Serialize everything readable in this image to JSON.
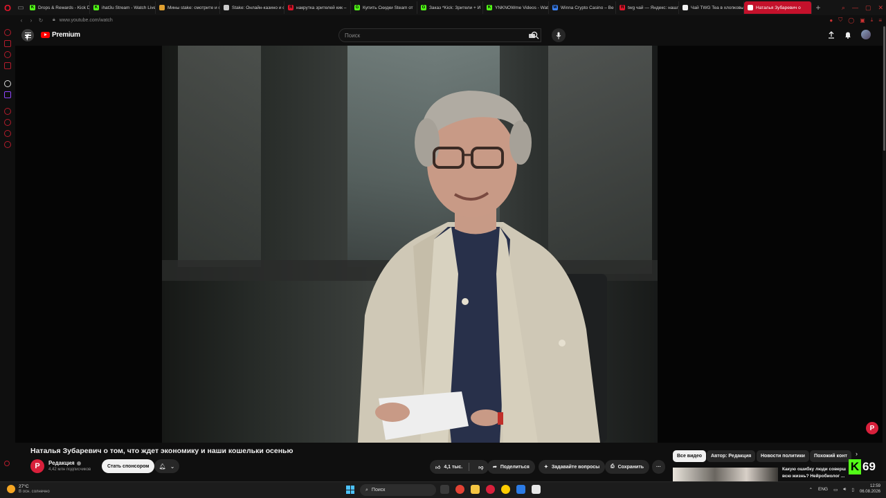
{
  "browser": {
    "tabs": [
      {
        "label": "Drops & Rewards - Kick Dr",
        "favicon_color": "#53fc18",
        "fav_text": "K"
      },
      {
        "label": "ihat3u Stream - Watch Live",
        "favicon_color": "#53fc18",
        "fav_text": "K"
      },
      {
        "label": "Мины stake: смотрите и с",
        "favicon_color": "#e0a030",
        "fav_text": ""
      },
      {
        "label": "Stake: Онлайн-казино и с",
        "favicon_color": "#cccccc",
        "fav_text": ""
      },
      {
        "label": "накрутка зрителей кик –",
        "favicon_color": "#e0162b",
        "fav_text": "Я"
      },
      {
        "label": "Купить Скидки Steam от",
        "favicon_color": "#53fc18",
        "fav_text": "G"
      },
      {
        "label": "Заказ *Kick: Зрители + И",
        "favicon_color": "#53fc18",
        "fav_text": "G"
      },
      {
        "label": "YNKNOWme Videos - Wat",
        "favicon_color": "#53fc18",
        "fav_text": "K"
      },
      {
        "label": "Winna Crypto Casino – Be",
        "favicon_color": "#3b82f6",
        "fav_text": "W"
      },
      {
        "label": "twg чай — Яндекс: нашл",
        "favicon_color": "#e0162b",
        "fav_text": "Я"
      },
      {
        "label": "Чай TWG Tea в хлопковы",
        "favicon_color": "#f1f1f1",
        "fav_text": ""
      },
      {
        "label": "Наталья Зубаревич о",
        "favicon_color": "#ffffff",
        "fav_text": "",
        "active": true
      }
    ],
    "new_tab": "+",
    "url": "www.youtube.com/watch"
  },
  "youtube": {
    "logo_text": "Premium",
    "search_placeholder": "Поиск",
    "video": {
      "title": "Наталья Зубаревич о том, что ждет экономику и наши кошельки осенью",
      "watermark": "Р"
    },
    "channel": {
      "avatar_letter": "Р",
      "name": "Редакция",
      "subscribers": "4,42 млн подписчиков",
      "sponsor_label": "Стать спонсором"
    },
    "actions": {
      "likes": "4,1 тыс.",
      "share": "Поделиться",
      "ask": "Задавайте вопросы",
      "save": "Сохранить",
      "more": "···"
    },
    "chips": [
      "Все видео",
      "Автор: Редакция",
      "Новости политики",
      "Похожий конт"
    ],
    "recommendation": {
      "title": "Какую ошибку люди соверш всю жизнь? Нейробиолог ..."
    },
    "kick_overlay": {
      "letter": "K",
      "count": "69"
    }
  },
  "taskbar": {
    "weather_temp": "27°C",
    "weather_desc": "В осн. солнечно",
    "search_label": "Поиск",
    "language": "ENG",
    "time": "12:59",
    "date": "06.08.2026"
  }
}
